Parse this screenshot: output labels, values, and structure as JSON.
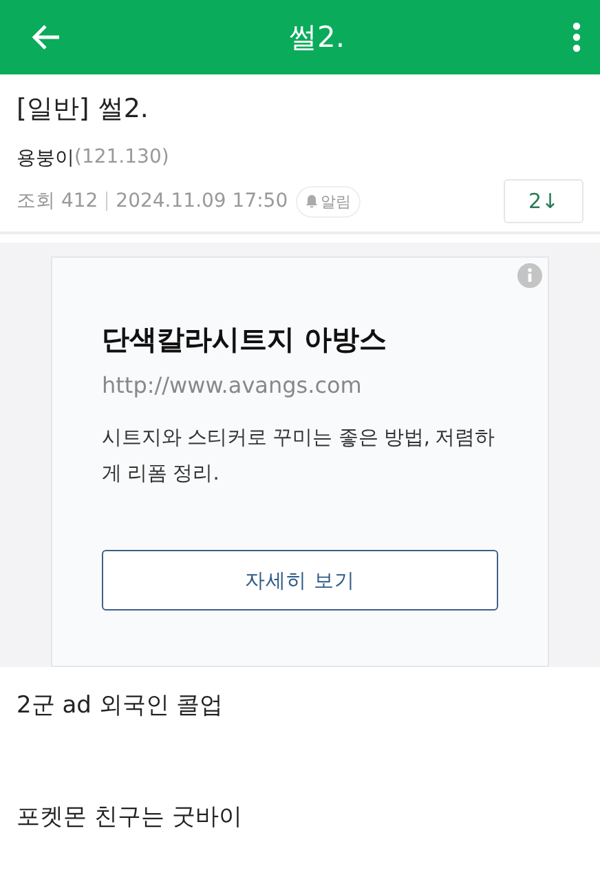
{
  "app_bar": {
    "title": "썰2."
  },
  "post": {
    "category": "[일반]",
    "title": "썰2.",
    "author": "용붕이",
    "author_ip": "(121.130)",
    "views": "조회 412",
    "date": "2024.11.09 17:50",
    "alert_label": "알림",
    "comment_count": "2↓"
  },
  "ad": {
    "headline": "단색칼라시트지 아방스",
    "url": "http://www.avangs.com",
    "description": "시트지와 스티커로 꾸미는 좋은 방법, 저렴하게 리폼 정리.",
    "button": "자세히 보기"
  },
  "body": [
    "2군 ad 외국인 콜업",
    "포켓몬 친구는 굿바이"
  ]
}
